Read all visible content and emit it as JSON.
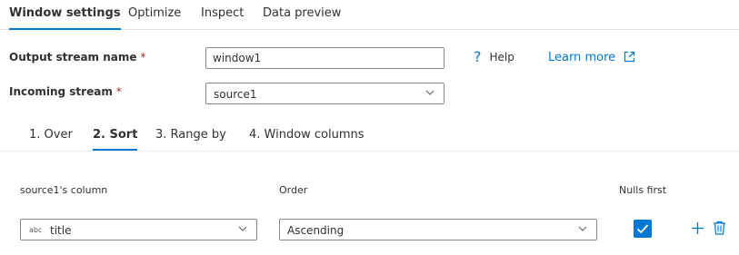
{
  "tabs": [
    {
      "label": "Window settings",
      "active": true
    },
    {
      "label": "Optimize",
      "active": false
    },
    {
      "label": "Inspect",
      "active": false
    },
    {
      "label": "Data preview",
      "active": false
    }
  ],
  "form": {
    "output_stream": {
      "label": "Output stream name",
      "required_mark": "*",
      "value": "window1"
    },
    "incoming_stream": {
      "label": "Incoming stream",
      "required_mark": "*",
      "value": "source1"
    }
  },
  "help": {
    "label": "Help",
    "icon": "question-icon"
  },
  "learn_more": {
    "label": "Learn more",
    "icon": "open-external-icon"
  },
  "sub_tabs": [
    {
      "label": "1. Over",
      "active": false
    },
    {
      "label": "2. Sort",
      "active": true
    },
    {
      "label": "3. Range by",
      "active": false
    },
    {
      "label": "4. Window columns",
      "active": false
    }
  ],
  "sort_table": {
    "headers": {
      "column": "source1's column",
      "order": "Order",
      "nulls_first": "Nulls first"
    },
    "rows": [
      {
        "type_badge": "abc",
        "column": "title",
        "order": "Ascending",
        "nulls_first": true
      }
    ]
  },
  "colors": {
    "accent": "#0078d4",
    "required": "#a4262c",
    "border": "#8a8886"
  }
}
